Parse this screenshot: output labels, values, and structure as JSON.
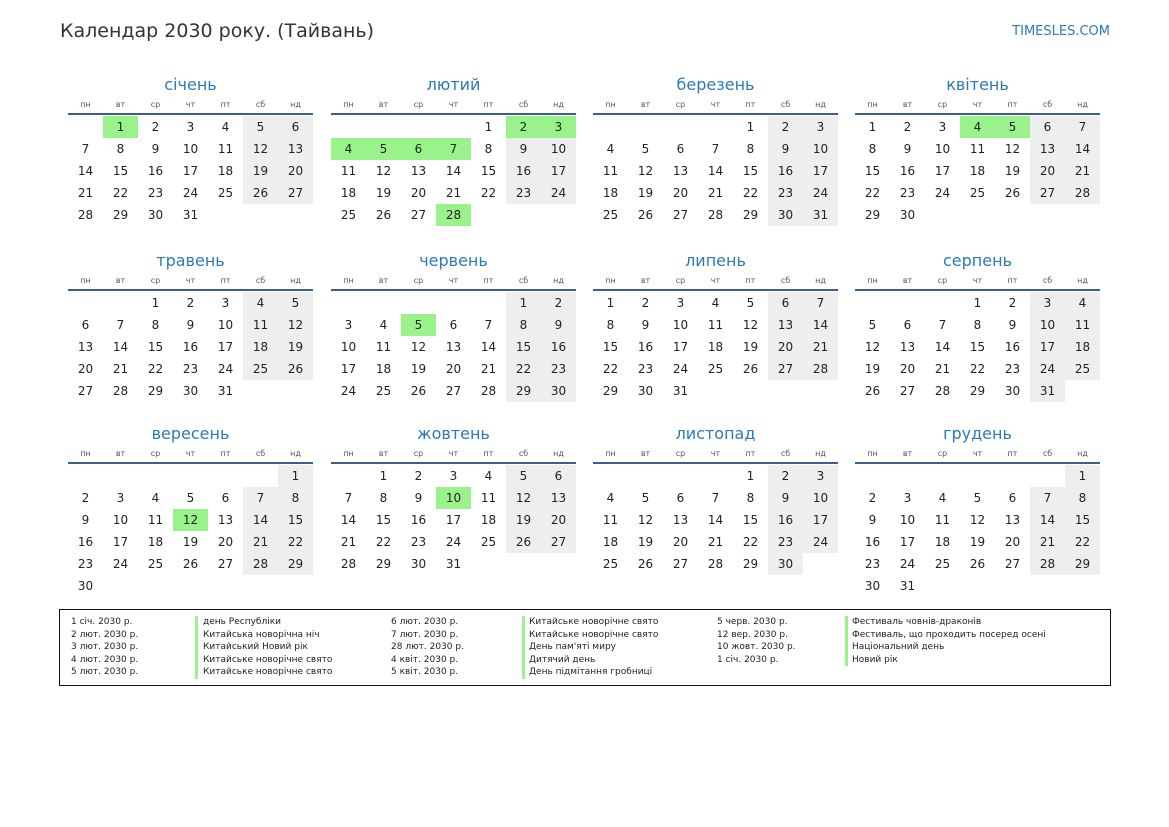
{
  "page": {
    "title": "Календар 2030 року. (Тайвань)",
    "site": "TIMESLES.COM"
  },
  "weekdays": [
    "пн",
    "вт",
    "ср",
    "чт",
    "пт",
    "сб",
    "нд"
  ],
  "colors": {
    "accent": "#2a7ab8",
    "holiday": "#99f28a",
    "weekend": "#eeeeee",
    "rule": "#3a5f8e"
  },
  "months": [
    {
      "name": "січень",
      "offset": 1,
      "days": 31,
      "holidays": [
        1
      ]
    },
    {
      "name": "лютий",
      "offset": 4,
      "days": 28,
      "holidays": [
        2,
        3,
        4,
        5,
        6,
        7,
        28
      ]
    },
    {
      "name": "березень",
      "offset": 4,
      "days": 31,
      "holidays": []
    },
    {
      "name": "квітень",
      "offset": 0,
      "days": 30,
      "holidays": [
        4,
        5
      ]
    },
    {
      "name": "травень",
      "offset": 2,
      "days": 31,
      "holidays": []
    },
    {
      "name": "червень",
      "offset": 5,
      "days": 30,
      "holidays": [
        5
      ]
    },
    {
      "name": "липень",
      "offset": 0,
      "days": 31,
      "holidays": []
    },
    {
      "name": "серпень",
      "offset": 3,
      "days": 31,
      "holidays": []
    },
    {
      "name": "вересень",
      "offset": 6,
      "days": 30,
      "holidays": [
        12
      ]
    },
    {
      "name": "жовтень",
      "offset": 1,
      "days": 31,
      "holidays": [
        10
      ]
    },
    {
      "name": "листопад",
      "offset": 4,
      "days": 30,
      "holidays": []
    },
    {
      "name": "грудень",
      "offset": 6,
      "days": 31,
      "holidays": []
    }
  ],
  "legend": [
    {
      "dates": [
        "1 січ. 2030 р.",
        "2 лют. 2030 р.",
        "3 лют. 2030 р.",
        "4 лют. 2030 р.",
        "5 лют. 2030 р."
      ],
      "names": [
        "день Республіки",
        "Китайська новорічна ніч",
        "Китайський Новий рік",
        "Китайське новорічне свято",
        "Китайське новорічне свято"
      ]
    },
    {
      "dates": [
        "6 лют. 2030 р.",
        "7 лют. 2030 р.",
        "28 лют. 2030 р.",
        "4 квіт. 2030 р.",
        "5 квіт. 2030 р."
      ],
      "names": [
        "Китайське новорічне свято",
        "Китайське новорічне свято",
        "День пам'яті миру",
        "Дитячий день",
        "День підмітання гробниці"
      ]
    },
    {
      "dates": [
        "5 черв. 2030 р.",
        "12 вер. 2030 р.",
        "10 жовт. 2030 р.",
        "1 січ. 2030 р."
      ],
      "names": [
        "Фестиваль човнів-драконів",
        "Фестиваль, що проходить посеред осені",
        "Національний день",
        "Новий рік"
      ]
    }
  ]
}
